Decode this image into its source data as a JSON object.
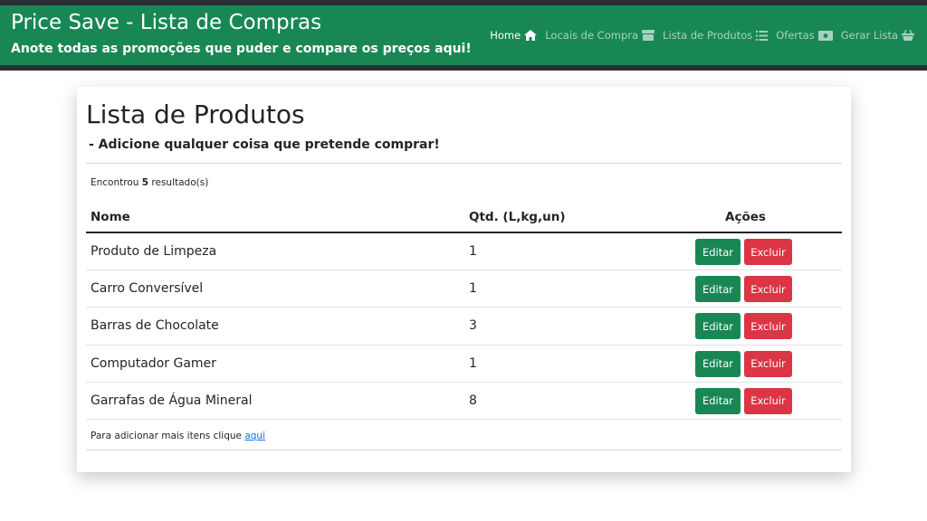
{
  "header": {
    "title": "Price Save - Lista de Compras",
    "subtitle": "Anote todas as promoções que puder e compare os preços aqui!",
    "nav": [
      {
        "label": "Home",
        "icon": "home-icon",
        "active": true
      },
      {
        "label": "Locais de Compra",
        "icon": "store-icon",
        "active": false
      },
      {
        "label": "Lista de Produtos",
        "icon": "list-icon",
        "active": false
      },
      {
        "label": "Ofertas",
        "icon": "money-icon",
        "active": false
      },
      {
        "label": "Gerar Lista",
        "icon": "basket-icon",
        "active": false
      }
    ]
  },
  "main": {
    "title": "Lista de Produtos",
    "subtitle": "- Adicione qualquer coisa que pretende comprar!",
    "results_prefix": "Encontrou ",
    "results_count": "5",
    "results_suffix": " resultado(s)",
    "table": {
      "columns": [
        "Nome",
        "Qtd. (L,kg,un)",
        "Ações"
      ],
      "rows": [
        {
          "name": "Produto de Limpeza",
          "qty": "1"
        },
        {
          "name": "Carro Conversível",
          "qty": "1"
        },
        {
          "name": "Barras de Chocolate",
          "qty": "3"
        },
        {
          "name": "Computador Gamer",
          "qty": "1"
        },
        {
          "name": "Garrafas de Água Mineral",
          "qty": "8"
        }
      ],
      "edit_label": "Editar",
      "delete_label": "Excluir"
    },
    "footer_prefix": "Para adicionar mais itens clique ",
    "footer_link": "aqui"
  },
  "colors": {
    "brand": "#198754",
    "danger": "#dc3545",
    "dark": "#2b2f33",
    "link": "#0d6efd"
  }
}
